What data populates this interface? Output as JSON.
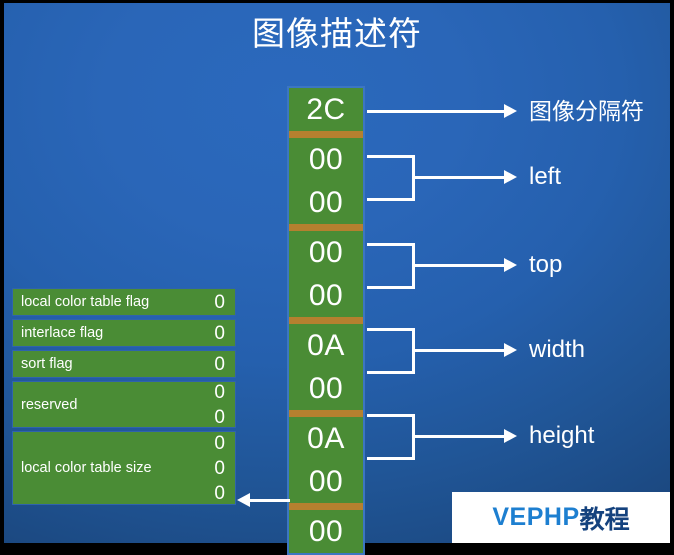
{
  "slide": {
    "title": "图像描述符",
    "background_color": "#2560ae",
    "accent_green": "#4a8c35",
    "separator_color": "#b5802f",
    "line_color": "#ffffff"
  },
  "hex_column": {
    "groups": [
      {
        "name": "separator",
        "cells": [
          "2C"
        ]
      },
      {
        "name": "left",
        "cells": [
          "00",
          "00"
        ]
      },
      {
        "name": "top",
        "cells": [
          "00",
          "00"
        ]
      },
      {
        "name": "width",
        "cells": [
          "0A",
          "00"
        ]
      },
      {
        "name": "height",
        "cells": [
          "0A",
          "00"
        ]
      },
      {
        "name": "packed",
        "cells": [
          "00"
        ]
      }
    ]
  },
  "annotations": [
    {
      "label": "图像分隔符"
    },
    {
      "label": "left"
    },
    {
      "label": "top"
    },
    {
      "label": "width"
    },
    {
      "label": "height"
    }
  ],
  "flags_table": {
    "rows": [
      {
        "label": "local color table flag",
        "values": [
          "0"
        ]
      },
      {
        "label": "interlace flag",
        "values": [
          "0"
        ]
      },
      {
        "label": "sort flag",
        "values": [
          "0"
        ]
      },
      {
        "label": "reserved",
        "values": [
          "0",
          "0"
        ]
      },
      {
        "label": "local color table size",
        "values": [
          "0",
          "0",
          "0"
        ]
      }
    ]
  },
  "watermark": {
    "text_primary": "VEPHP",
    "text_secondary": "教程",
    "color_primary": "#1d7fd0",
    "color_secondary": "#14427e",
    "background": "#ffffff"
  }
}
